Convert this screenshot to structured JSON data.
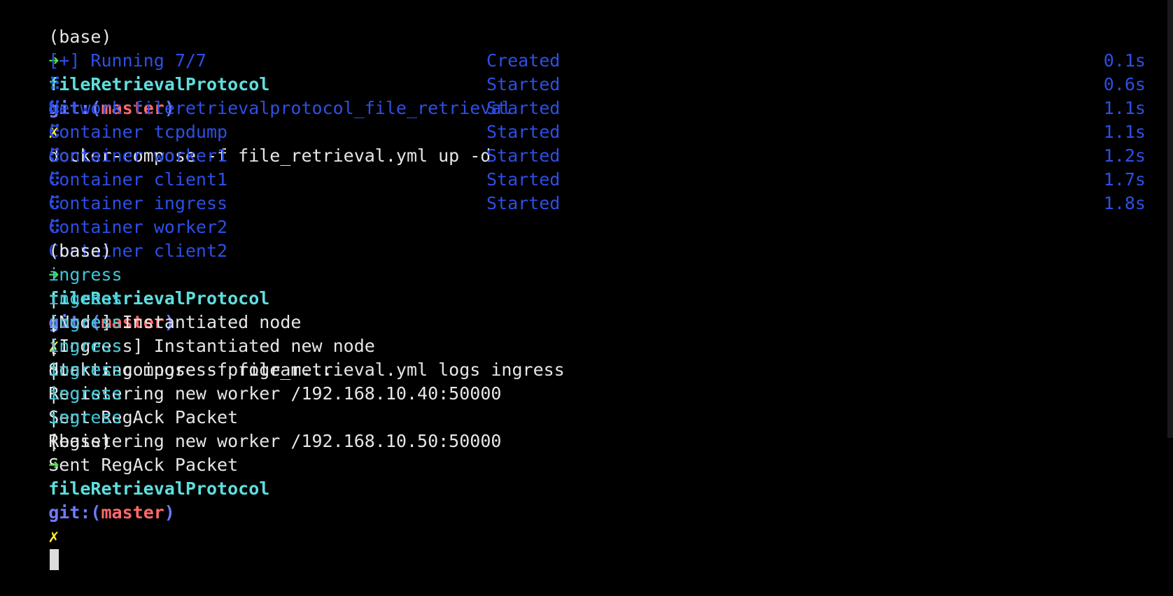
{
  "prompt": {
    "env": "(base)",
    "arrow": "➜",
    "dir": "fileRetrievalProtocol",
    "git_prefix": "git:(",
    "branch": "master",
    "git_suffix": ")",
    "dirty": "✗"
  },
  "commands": {
    "up": "docker-compose -f file_retrieval.yml up -d",
    "logs": "docker-compose -f file_retrieval.yml logs ingress"
  },
  "running": {
    "header": "[+] Running 7/7",
    "items": [
      {
        "bullet": "⠿",
        "name": "Network fileretrievalprotocol_file_retrieval",
        "status": "Created",
        "time": "0.1s"
      },
      {
        "bullet": "⠿",
        "name": "Container tcpdump",
        "status": "Started",
        "time": "0.6s"
      },
      {
        "bullet": "⠿",
        "name": "Container worker1",
        "status": "Started",
        "time": "1.1s"
      },
      {
        "bullet": "⠿",
        "name": "Container client1",
        "status": "Started",
        "time": "1.1s"
      },
      {
        "bullet": "⠿",
        "name": "Container ingress",
        "status": "Started",
        "time": "1.2s"
      },
      {
        "bullet": "⠿",
        "name": "Container worker2",
        "status": "Started",
        "time": "1.7s"
      },
      {
        "bullet": "⠿",
        "name": "Container client2",
        "status": "Started",
        "time": "1.8s"
      }
    ]
  },
  "logs": [
    {
      "service": "ingress  ",
      "sep": "|",
      "message": "[Node] Instantiated node"
    },
    {
      "service": "ingress  ",
      "sep": "|",
      "message": "[Ingress] Instantiated new node"
    },
    {
      "service": "ingress  ",
      "sep": "|",
      "message": "Starting ingress program..."
    },
    {
      "service": "ingress  ",
      "sep": "|",
      "message": "Registering new worker /192.168.10.40:50000"
    },
    {
      "service": "ingress  ",
      "sep": "|",
      "message": "Sent RegAck Packet"
    },
    {
      "service": "ingress  ",
      "sep": "|",
      "message": "Registering new worker /192.168.10.50:50000"
    },
    {
      "service": "ingress  ",
      "sep": "|",
      "message": "Sent RegAck Packet"
    }
  ],
  "colors": {
    "background": "#000000",
    "text": "#e6e6e6",
    "arrow": "#4ee04e",
    "dir": "#5fdede",
    "git": "#6e7bff",
    "branch": "#ff6a6a",
    "dirty": "#ffee33",
    "compose_output": "#2d4fe6",
    "service_name": "#3cc7d9"
  }
}
